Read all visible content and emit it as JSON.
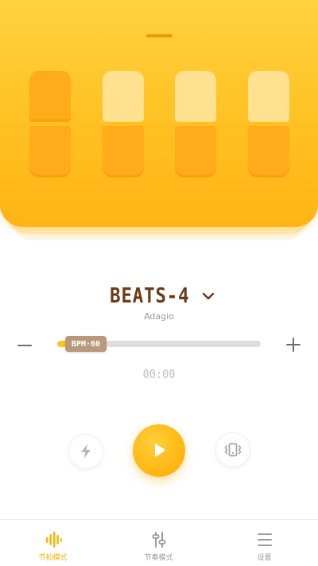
{
  "beats": [
    {
      "accent": true
    },
    {
      "accent": false
    },
    {
      "accent": false
    },
    {
      "accent": false
    }
  ],
  "pattern": {
    "title": "BEATS-4",
    "tempo_name": "Adagio"
  },
  "bpm": {
    "label": "BPM·60",
    "fill_fraction": 0.05
  },
  "timer": "00:00",
  "controls": {
    "left_icon": "lightning-icon",
    "center_icon": "play-icon",
    "right_icon": "vibrate-icon"
  },
  "nav": {
    "items": [
      {
        "label": "节拍模式",
        "icon": "waveform-icon",
        "active": true
      },
      {
        "label": "节奏模式",
        "icon": "sliders-icon",
        "active": false
      },
      {
        "label": "设置",
        "icon": "menu-icon",
        "active": false
      }
    ]
  },
  "colors": {
    "accent": "#ffb000",
    "title": "#6b3a16",
    "beat_on": "#ffab1a",
    "beat_off": "#ffe190"
  }
}
